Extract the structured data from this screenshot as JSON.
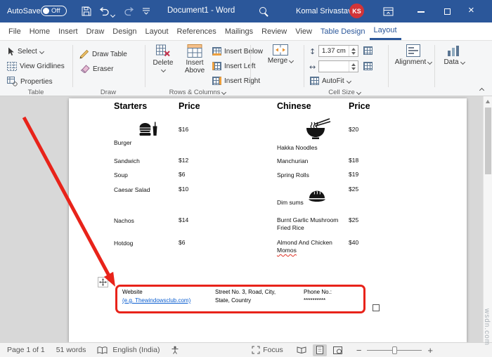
{
  "colors": {
    "titlebar_bg": "#2b579a",
    "contextual_tab": "#2b579a",
    "avatar_bg": "#d13438",
    "annotation_red": "#e8231a",
    "hyperlink": "#0b5ed0"
  },
  "titlebar": {
    "autosave_label": "AutoSave",
    "autosave_state": "Off",
    "document_title": "Document1 - Word",
    "user_name": "Komal Srivastava",
    "user_initials": "KS"
  },
  "tabs": [
    {
      "label": "File"
    },
    {
      "label": "Home"
    },
    {
      "label": "Insert"
    },
    {
      "label": "Draw"
    },
    {
      "label": "Design"
    },
    {
      "label": "Layout"
    },
    {
      "label": "References"
    },
    {
      "label": "Mailings"
    },
    {
      "label": "Review"
    },
    {
      "label": "View"
    },
    {
      "label": "Table Design"
    },
    {
      "label": "Layout"
    }
  ],
  "ribbon": {
    "table_group": {
      "select": "Select",
      "view_gridlines": "View Gridlines",
      "properties": "Properties",
      "label": "Table"
    },
    "draw_group": {
      "draw_table": "Draw Table",
      "eraser": "Eraser",
      "label": "Draw"
    },
    "rows_columns_group": {
      "delete": "Delete",
      "insert_above": "Insert Above",
      "insert_below": "Insert Below",
      "insert_left": "Insert Left",
      "insert_right": "Insert Right",
      "label": "Rows & Columns"
    },
    "merge_group": {
      "merge": "Merge"
    },
    "cell_size_group": {
      "height_value": "1.37 cm",
      "width_value": "",
      "autofit": "AutoFit",
      "label": "Cell Size"
    },
    "alignment_group": {
      "label": "Alignment"
    },
    "data_group": {
      "label": "Data"
    }
  },
  "document": {
    "headers": [
      "Starters",
      "Price",
      "Chinese",
      "Price"
    ],
    "starters": [
      {
        "name": "Burger",
        "price": "$16"
      },
      {
        "name": "Sandwich",
        "price": "$12"
      },
      {
        "name": "Soup",
        "price": "$6"
      },
      {
        "name": "Caesar Salad",
        "price": "$10"
      },
      {
        "name": "Nachos",
        "price": "$14"
      },
      {
        "name": "Hotdog",
        "price": "$6"
      }
    ],
    "chinese": [
      {
        "name": "Hakka Noodles",
        "price": "$20"
      },
      {
        "name": "Manchurian",
        "price": "$18"
      },
      {
        "name": "Spring Rolls",
        "price": "$19"
      },
      {
        "name": "Dim sums",
        "price": "$25"
      },
      {
        "name": "Burnt Garlic Mushroom Fried Rice",
        "price": "$25"
      },
      {
        "name": "Almond And Chicken",
        "misspelled": "Momos",
        "price": "$40"
      }
    ],
    "footer": {
      "website_label": "Website",
      "website_link": "(e.g. Thewindowsclub.com)",
      "address_line1": "Street No. 3, Road, City,",
      "address_line2": "State, Country",
      "phone_label": "Phone No.:",
      "phone_value": "**********"
    }
  },
  "statusbar": {
    "page_indicator": "Page 1 of 1",
    "word_count": "51 words",
    "language": "English (India)",
    "focus_label": "Focus"
  },
  "watermark": "wsdn.com",
  "icons": {
    "titlebar": [
      "save-icon",
      "undo-icon",
      "redo-icon",
      "customize-quick-access-icon",
      "search-icon",
      "ribbon-display-options-icon",
      "minimize-icon",
      "maximize-icon",
      "close-icon"
    ],
    "tab_row": [
      "share-icon",
      "comments-icon"
    ],
    "ribbon": [
      "select-cursor-icon",
      "view-gridlines-icon",
      "properties-icon",
      "draw-table-pencil-icon",
      "eraser-icon",
      "delete-table-icon",
      "insert-above-icon",
      "insert-below-icon",
      "insert-left-icon",
      "insert-right-icon",
      "merge-cells-icon",
      "row-height-icon",
      "column-width-icon",
      "distribute-rows-icon",
      "distribute-columns-icon",
      "autofit-icon",
      "alignment-icon",
      "data-icon",
      "dialog-launcher-icon",
      "collapse-ribbon-icon"
    ],
    "document": [
      "burger-icon",
      "noodles-bowl-icon",
      "dumpling-icon",
      "table-move-handle-icon"
    ],
    "statusbar": [
      "proofing-book-icon",
      "accessibility-icon",
      "focus-icon",
      "read-mode-icon",
      "print-layout-icon",
      "web-layout-icon",
      "zoom-out-icon",
      "zoom-in-icon"
    ]
  }
}
